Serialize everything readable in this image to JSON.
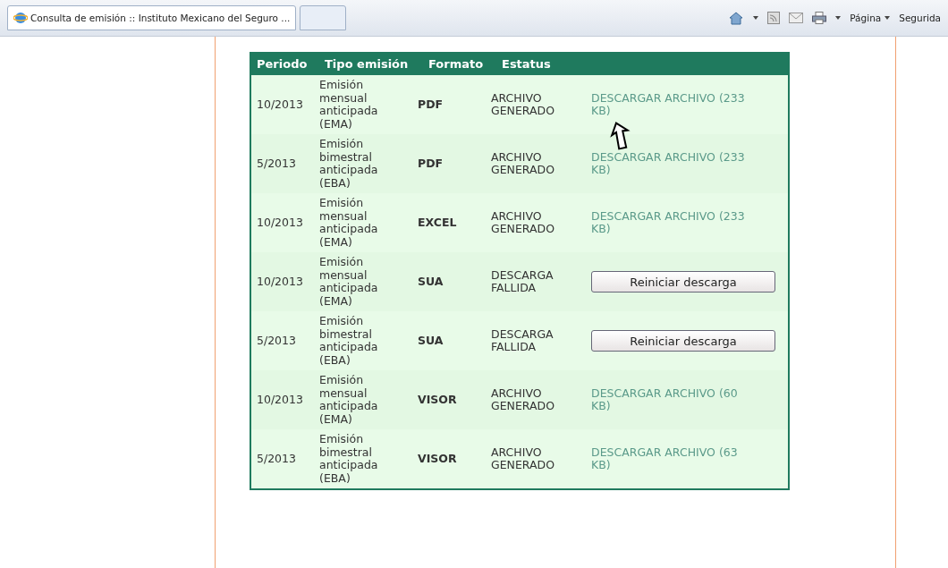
{
  "browser": {
    "tab_title": "Consulta de emisión :: Instituto Mexicano del Seguro ...",
    "toolbar": [
      "Página",
      "Segurida"
    ]
  },
  "table": {
    "columns": [
      "Periodo",
      "Tipo emisión",
      "Formato",
      "Estatus"
    ],
    "rows": [
      {
        "period": "10/2013",
        "type": "Emisión mensual anticipada (EMA)",
        "format": "PDF",
        "status": "ARCHIVO GENERADO",
        "action": {
          "kind": "link",
          "label": "DESCARGAR ARCHIVO (233 KB)"
        }
      },
      {
        "period": "5/2013",
        "type": "Emisión bimestral anticipada (EBA)",
        "format": "PDF",
        "status": "ARCHIVO GENERADO",
        "action": {
          "kind": "link",
          "label": "DESCARGAR ARCHIVO (233 KB)"
        }
      },
      {
        "period": "10/2013",
        "type": "Emisión mensual anticipada (EMA)",
        "format": "EXCEL",
        "status": "ARCHIVO GENERADO",
        "action": {
          "kind": "link",
          "label": "DESCARGAR ARCHIVO (233 KB)"
        }
      },
      {
        "period": "10/2013",
        "type": "Emisión mensual anticipada (EMA)",
        "format": "SUA",
        "status": "DESCARGA FALLIDA",
        "action": {
          "kind": "button",
          "label": "Reiniciar descarga"
        }
      },
      {
        "period": "5/2013",
        "type": "Emisión bimestral anticipada (EBA)",
        "format": "SUA",
        "status": "DESCARGA FALLIDA",
        "action": {
          "kind": "button",
          "label": "Reiniciar descarga"
        }
      },
      {
        "period": "10/2013",
        "type": "Emisión mensual anticipada (EMA)",
        "format": "VISOR",
        "status": "ARCHIVO GENERADO",
        "action": {
          "kind": "link",
          "label": "DESCARGAR ARCHIVO (60 KB)"
        }
      },
      {
        "period": "5/2013",
        "type": "Emisión bimestral anticipada (EBA)",
        "format": "VISOR",
        "status": "ARCHIVO GENERADO",
        "action": {
          "kind": "link",
          "label": "DESCARGAR ARCHIVO (63 KB)"
        }
      }
    ]
  }
}
